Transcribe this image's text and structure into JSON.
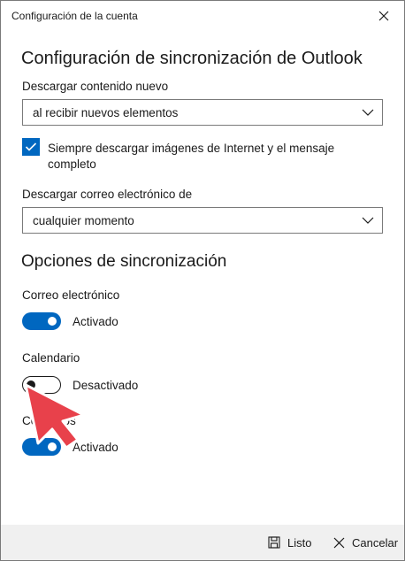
{
  "window": {
    "title": "Configuración de la cuenta"
  },
  "sync_settings": {
    "heading": "Configuración de sincronización de Outlook",
    "download_label": "Descargar contenido nuevo",
    "download_value": "al recibir nuevos elementos",
    "images_checkbox_label": "Siempre descargar imágenes de Internet y el mensaje completo",
    "images_checkbox_checked": true,
    "email_from_label": "Descargar correo electrónico de",
    "email_from_value": "cualquier momento"
  },
  "sync_options": {
    "heading": "Opciones de sincronización",
    "items": [
      {
        "label": "Correo electrónico",
        "state": "Activado",
        "on": true
      },
      {
        "label": "Calendario",
        "state": "Desactivado",
        "on": false
      },
      {
        "label": "Contactos",
        "state": "Activado",
        "on": true
      }
    ]
  },
  "footer": {
    "done_label": "Listo",
    "cancel_label": "Cancelar"
  },
  "colors": {
    "accent": "#0067c0",
    "pointer_arrow": "#e8414b",
    "footer_bg": "#f0f0f0"
  },
  "icons": {
    "close": "close-icon",
    "chevron": "chevron-down-icon",
    "check": "check-icon",
    "save": "save-icon",
    "cancel": "x-icon",
    "pointer": "pointer-arrow-icon"
  }
}
